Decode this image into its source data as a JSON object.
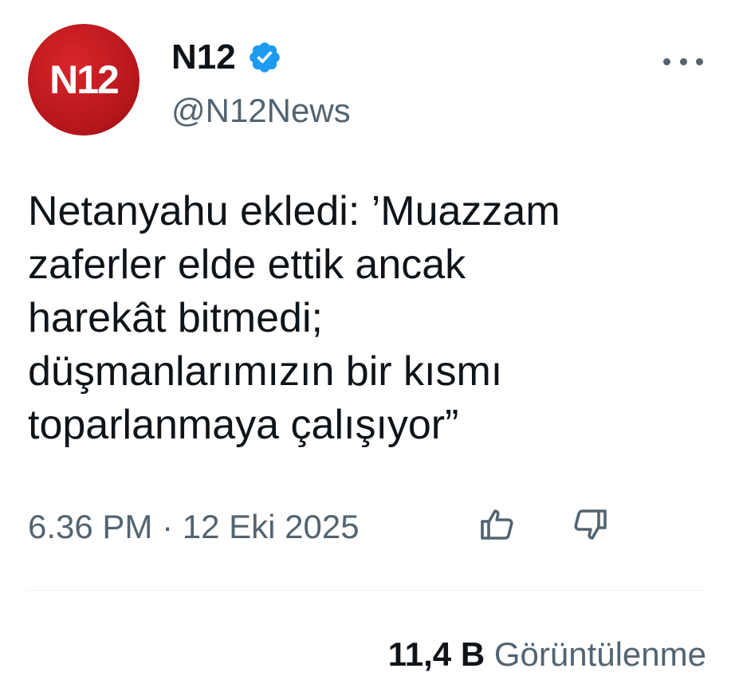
{
  "author": {
    "avatar_text": "N12",
    "display_name": "N12",
    "handle": "@N12News",
    "verified": true,
    "avatar_color": "#c41e24",
    "verified_color": "#1d9bf0"
  },
  "tweet": {
    "text": "Netanyahu ekledi: ’Muazzam\nzaferler elde ettik ancak\nharekât bitmedi;\ndüşmanlarımızın bir kısmı\ntoparlanmaya çalışıyor”",
    "timestamp": "6.36 PM · 12 Eki 2025",
    "views_count": "11,4 B",
    "views_label": "Görüntülenme"
  },
  "icons": {
    "more": "more-horizontal-icon",
    "like": "thumbs-up-icon",
    "dislike": "thumbs-down-icon",
    "verified": "verified-badge-icon"
  }
}
